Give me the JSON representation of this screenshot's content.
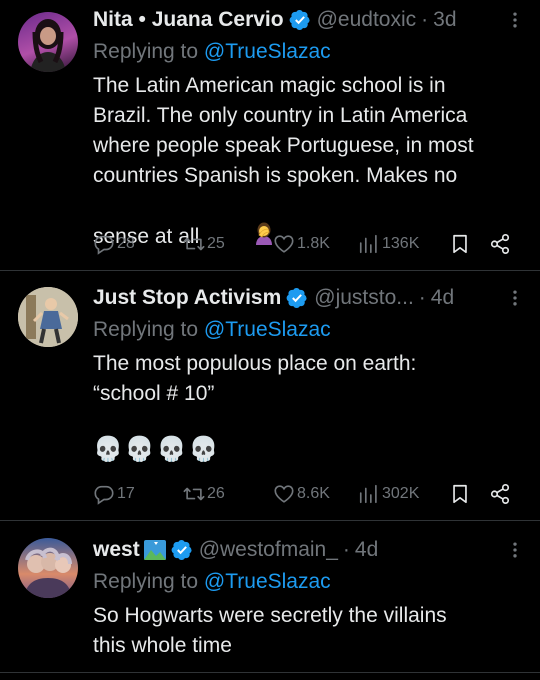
{
  "tweets": [
    {
      "name": "Nita • Juana Cervio",
      "handle": "@eudtoxic",
      "time": "3d",
      "replying_prefix": "Replying to ",
      "replying_to": "@TrueSlazac",
      "text": "The Latin American magic school is in\nBrazil. The only country in Latin America\nwhere people speak Portuguese, in most\ncountries Spanish is spoken. Makes no\nsense at all",
      "text_emoji": "🤦‍♀️",
      "replies": "28",
      "reposts": "25",
      "likes": "1.8K",
      "views": "136K"
    },
    {
      "name": "Just Stop Activism",
      "handle": "@juststo...",
      "time": "4d",
      "replying_prefix": "Replying to ",
      "replying_to": "@TrueSlazac",
      "text": "The most populous place on earth:\n“school # 10”",
      "emoji_line": "💀💀💀💀",
      "replies": "17",
      "reposts": "26",
      "likes": "8.6K",
      "views": "302K"
    },
    {
      "name": "west",
      "handle": "@westofmain_",
      "time": "4d",
      "replying_prefix": "Replying to ",
      "replying_to": "@TrueSlazac",
      "text": "So Hogwarts were secretly the villains\nthis whole time"
    }
  ],
  "icons": {
    "more": "more-icon",
    "verified": "verified-badge-icon",
    "reply": "reply-icon",
    "repost": "repost-icon",
    "like": "like-icon",
    "views": "views-icon",
    "bookmark": "bookmark-icon",
    "share": "share-icon",
    "flag": "landscape-flag-emoji"
  },
  "colors": {
    "background": "#000000",
    "text": "#e7e9ea",
    "muted": "#71767b",
    "link": "#1d9bf0",
    "verified": "#1d9bf0",
    "divider": "#2f3336"
  }
}
